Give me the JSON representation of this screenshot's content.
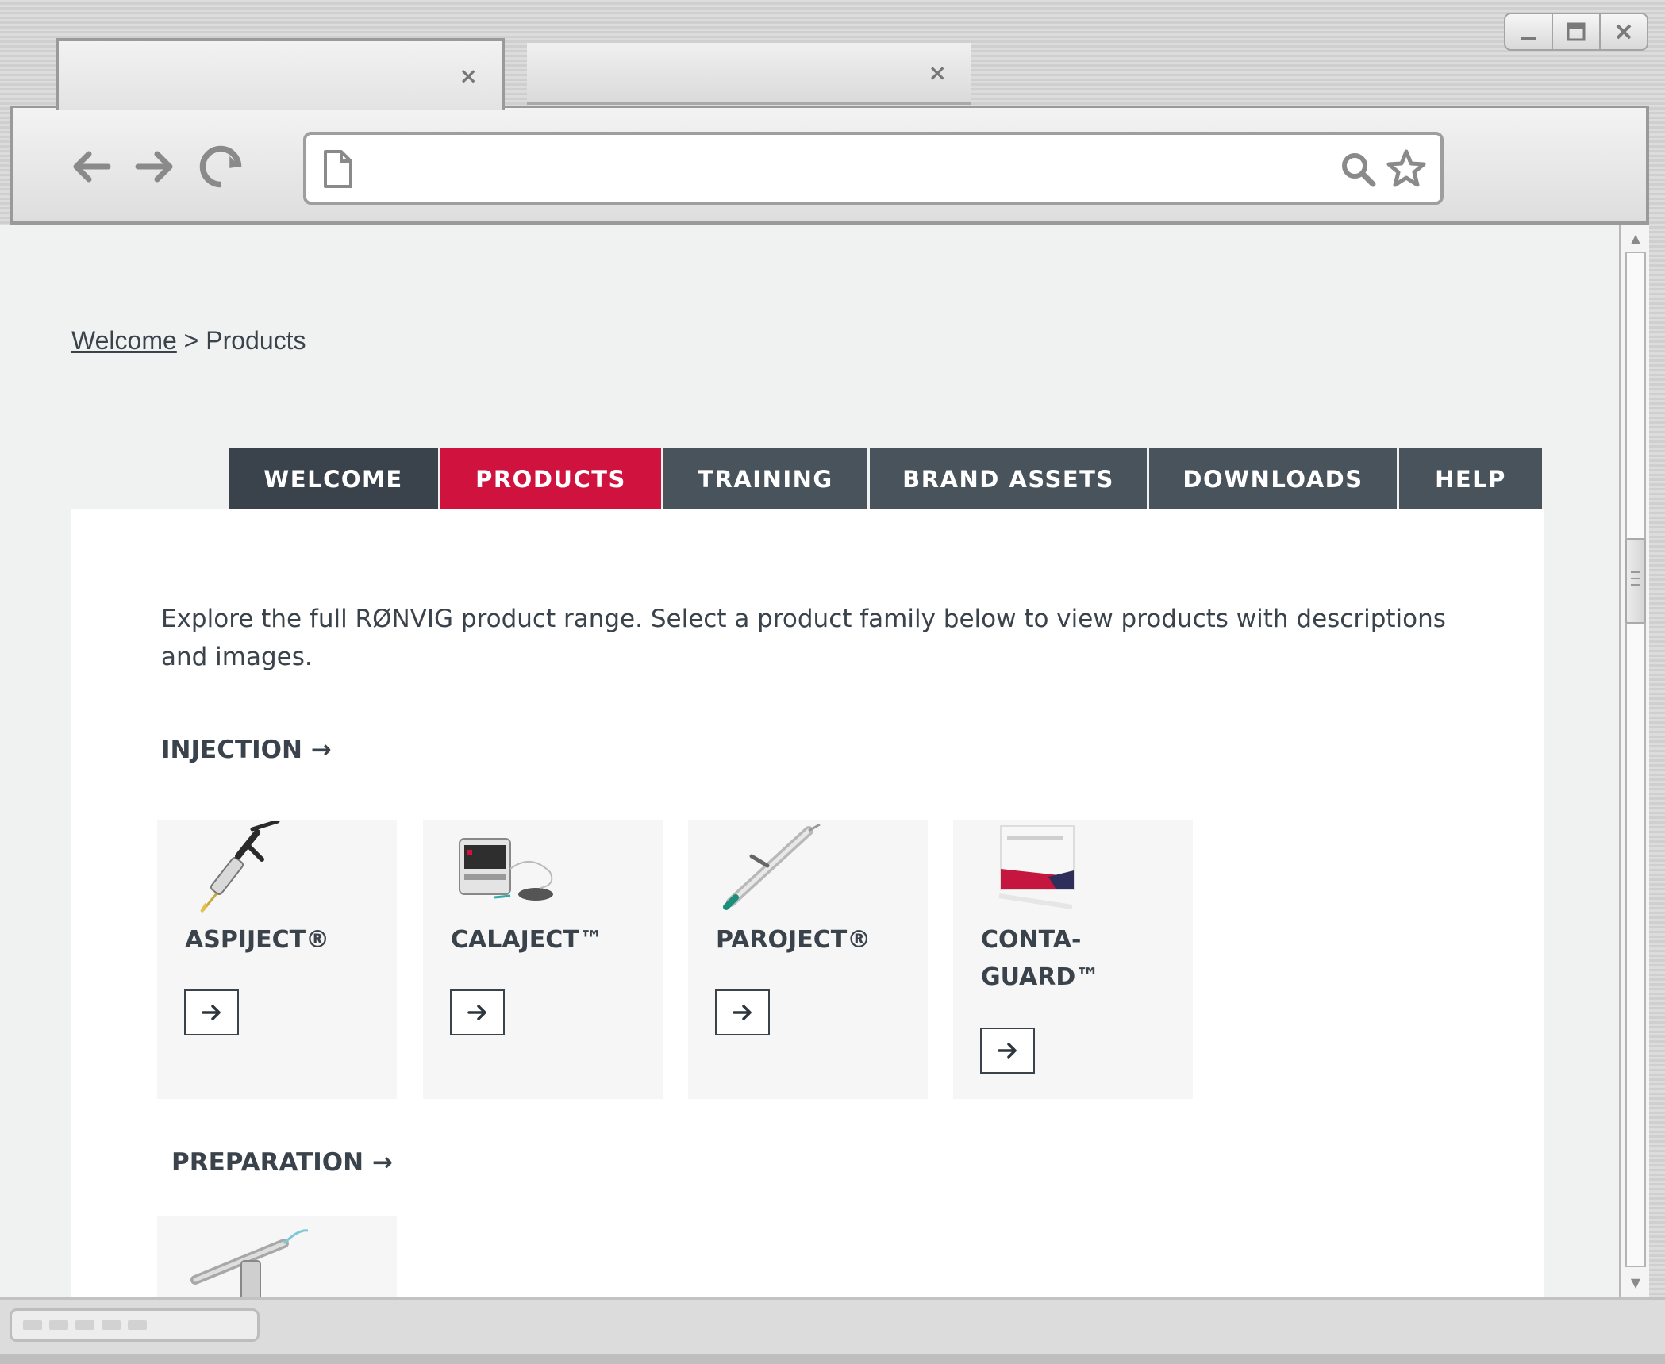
{
  "window": {
    "controls": [
      "minimize",
      "maximize",
      "close"
    ]
  },
  "tabs": [
    {
      "close_label": "×"
    },
    {
      "close_label": "×"
    }
  ],
  "address_bar": {
    "value": ""
  },
  "breadcrumb": {
    "home_link": "Welcome",
    "separator": ">",
    "current": "Products"
  },
  "nav": {
    "items": [
      "WELCOME",
      "PRODUCTS",
      "TRAINING",
      "BRAND ASSETS",
      "DOWNLOADS",
      "HELP"
    ],
    "active": "PRODUCTS"
  },
  "intro": "Explore the full RØNVIG product range. Select a product family below to view products with descriptions and images.",
  "families": [
    {
      "title": "INJECTION →",
      "products": [
        "ASPIJECT®",
        "CALAJECT™",
        "PAROJECT®",
        "CONTA-GUARD™"
      ]
    },
    {
      "title": "PREPARATION →",
      "products": []
    }
  ],
  "colors": {
    "nav_dark": "#3a434b",
    "nav_mid": "#48535c",
    "accent": "#d0123f",
    "text": "#3a434b",
    "page_bg": "#f0f1f1"
  },
  "icons": {
    "product_button": "arrow-right-icon",
    "scrollbar_up": "chevron-up-icon",
    "scrollbar_down": "chevron-down-icon"
  }
}
